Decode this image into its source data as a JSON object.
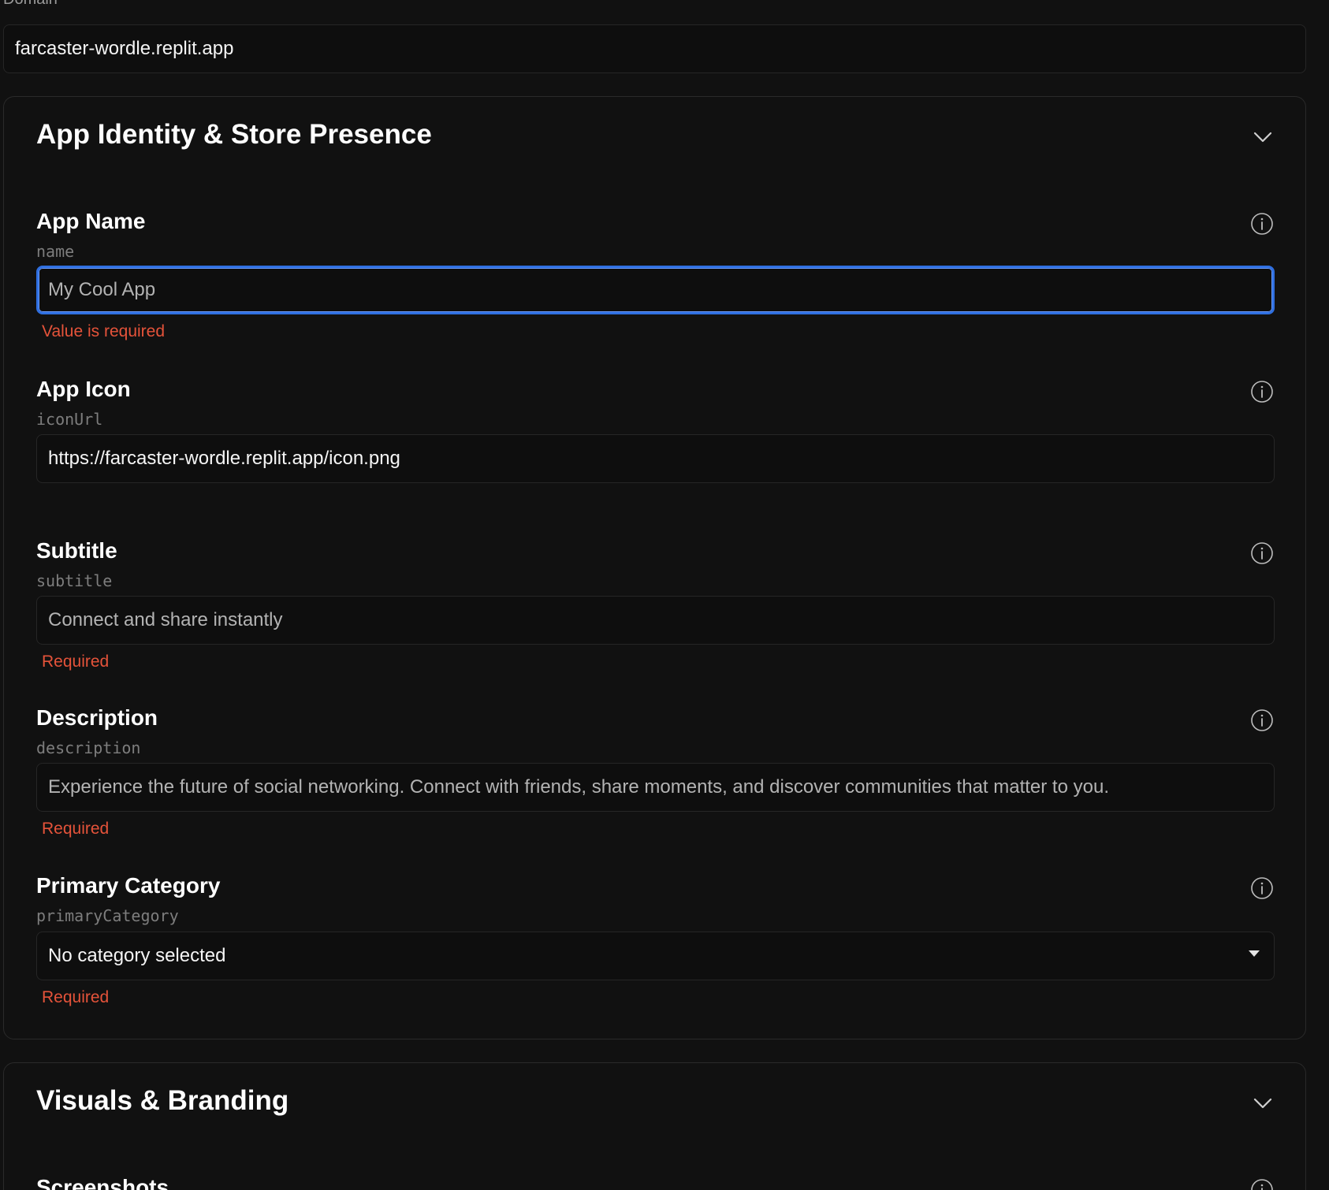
{
  "domain": {
    "label": "Domain",
    "value": "farcaster-wordle.replit.app"
  },
  "sections": {
    "identity": {
      "title": "App Identity & Store Presence",
      "fields": {
        "name": {
          "label": "App Name",
          "key": "name",
          "placeholder": "My Cool App",
          "error": "Value is required"
        },
        "icon": {
          "label": "App Icon",
          "key": "iconUrl",
          "value": "https://farcaster-wordle.replit.app/icon.png"
        },
        "subtitle": {
          "label": "Subtitle",
          "key": "subtitle",
          "placeholder": "Connect and share instantly",
          "error": "Required"
        },
        "description": {
          "label": "Description",
          "key": "description",
          "placeholder": "Experience the future of social networking. Connect with friends, share moments, and discover communities that matter to you.",
          "error": "Required"
        },
        "primaryCategory": {
          "label": "Primary Category",
          "key": "primaryCategory",
          "selected": "No category selected",
          "error": "Required"
        }
      }
    },
    "visuals": {
      "title": "Visuals & Branding",
      "fields": {
        "screenshots": {
          "label": "Screenshots"
        }
      }
    }
  },
  "colors": {
    "background": "#111111",
    "error": "#e5533a",
    "focus": "#2f6fe0"
  },
  "icons": {
    "info": "info-circle-icon",
    "collapse": "chevron-down-icon",
    "select": "caret-down-icon"
  }
}
